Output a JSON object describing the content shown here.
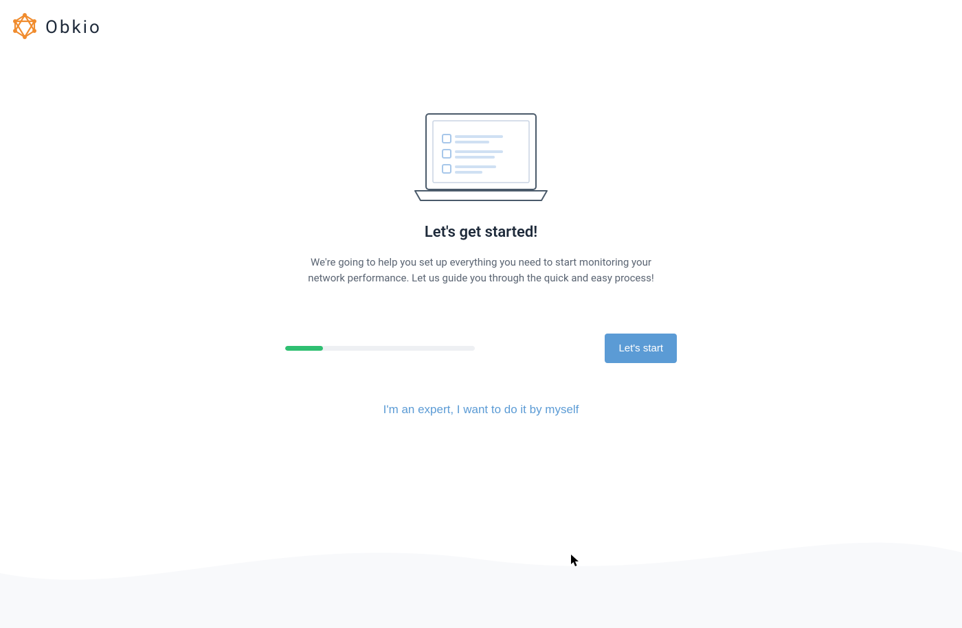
{
  "header": {
    "brand": "Obkio"
  },
  "onboarding": {
    "title": "Let's get started!",
    "description": "We're going to help you set up everything you need to start monitoring your network performance. Let us guide you through the quick and easy process!",
    "progress_percent": 20,
    "start_button_label": "Let's start",
    "expert_link_label": "I'm an expert, I want to do it by myself"
  },
  "colors": {
    "accent": "#5b9bd5",
    "success": "#2fbf71",
    "brand_icon": "#f08c2e",
    "text_dark": "#1e2a3a",
    "text_muted": "#5a6472",
    "track": "#eef0f3"
  }
}
